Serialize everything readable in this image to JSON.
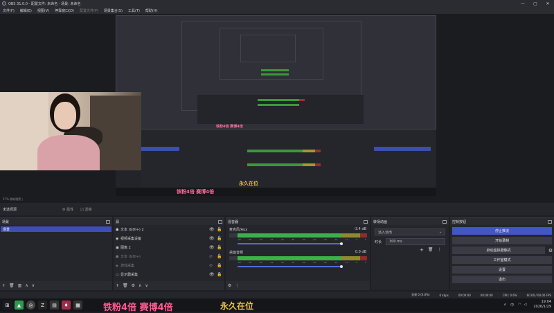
{
  "window": {
    "title": "OBS 31.0.0 - 配置文件: 未命名 - 场景: 未命名",
    "controls": [
      "—",
      "▢",
      "✕"
    ]
  },
  "menu": [
    {
      "label": "文件(F)",
      "enabled": true
    },
    {
      "label": "编辑(E)",
      "enabled": true
    },
    {
      "label": "视图(V)",
      "enabled": true
    },
    {
      "label": "停靠窗口(D)",
      "enabled": true
    },
    {
      "label": "配置文件(P)",
      "enabled": false
    },
    {
      "label": "场景集合(S)",
      "enabled": true
    },
    {
      "label": "工具(T)",
      "enabled": true
    },
    {
      "label": "帮助(H)",
      "enabled": true
    }
  ],
  "preview": {
    "overlay_pink": "铁粉4倍 赛博4倍",
    "overlay_gold": "永久在位"
  },
  "status_line": "57%  微软雅黑 |",
  "scene_bar": {
    "no_scene": "未选择源",
    "props": "⚙ 属性",
    "filters": "◫ 滤镜"
  },
  "scenes": {
    "title": "场景",
    "items": [
      "场景"
    ],
    "footer": [
      "+",
      "🗑",
      "▥",
      "∧",
      "∨"
    ]
  },
  "sources": {
    "title": "源",
    "items": [
      {
        "icon": "☗",
        "label": "文本 (GDI+) 2",
        "dim": false
      },
      {
        "icon": "◉",
        "label": "视频采集设备",
        "dim": false
      },
      {
        "icon": "▣",
        "label": "图像 2",
        "dim": false
      },
      {
        "icon": "☗",
        "label": "文本 (GDI+)",
        "dim": true
      },
      {
        "icon": "◈",
        "label": "游戏采集",
        "dim": true
      },
      {
        "icon": "▭",
        "label": "显示器采集",
        "dim": false
      }
    ],
    "footer": [
      "+",
      "🗑",
      "⚙",
      "∧",
      "∨"
    ]
  },
  "mixer": {
    "title": "混音器",
    "channels": [
      {
        "name": "麦克风/Aux",
        "db": "-3.4 dB"
      },
      {
        "name": "桌面音频",
        "db": "0.0 dB"
      }
    ],
    "ticks": [
      "-60",
      "-55",
      "-50",
      "-45",
      "-40",
      "-35",
      "-30",
      "-25",
      "-20",
      "-15",
      "-10",
      "-5",
      "0"
    ],
    "footer": [
      "⚙",
      "⋮"
    ]
  },
  "transitions": {
    "title": "转场动画",
    "selected": "淡入淡出",
    "duration_label": "时长",
    "duration": "300 ms",
    "footer": [
      "+",
      "🗑",
      "⋮"
    ]
  },
  "controls": {
    "title": "控制按钮",
    "stop_stream": "停止推流",
    "start_record": "开始录制",
    "virtual_cam": "启动虚拟摄像机",
    "studio_mode": "工作室模式",
    "settings": "设置",
    "exit": "退出"
  },
  "obs_status": {
    "dropped": "丢帧 0 (0.0%)",
    "bitrate": "0 kbps",
    "rec_time": "00:00:00",
    "stream_time": "00:00:00",
    "cpu": "CPU: 0.6%",
    "fps": "60.00 / 60.00 FPS"
  },
  "taskbar": {
    "text_pink": "铁粉4倍 赛博4倍",
    "text_gold": "永久在位",
    "lang": "中",
    "time": "19:04",
    "date": "2026/1/29"
  },
  "colors": {
    "accent": "#4256c4",
    "selected_scene": "#3f4db6",
    "meter_green": "#3cb04a",
    "meter_yellow": "#8f8a2e",
    "meter_red": "#922c2c"
  }
}
